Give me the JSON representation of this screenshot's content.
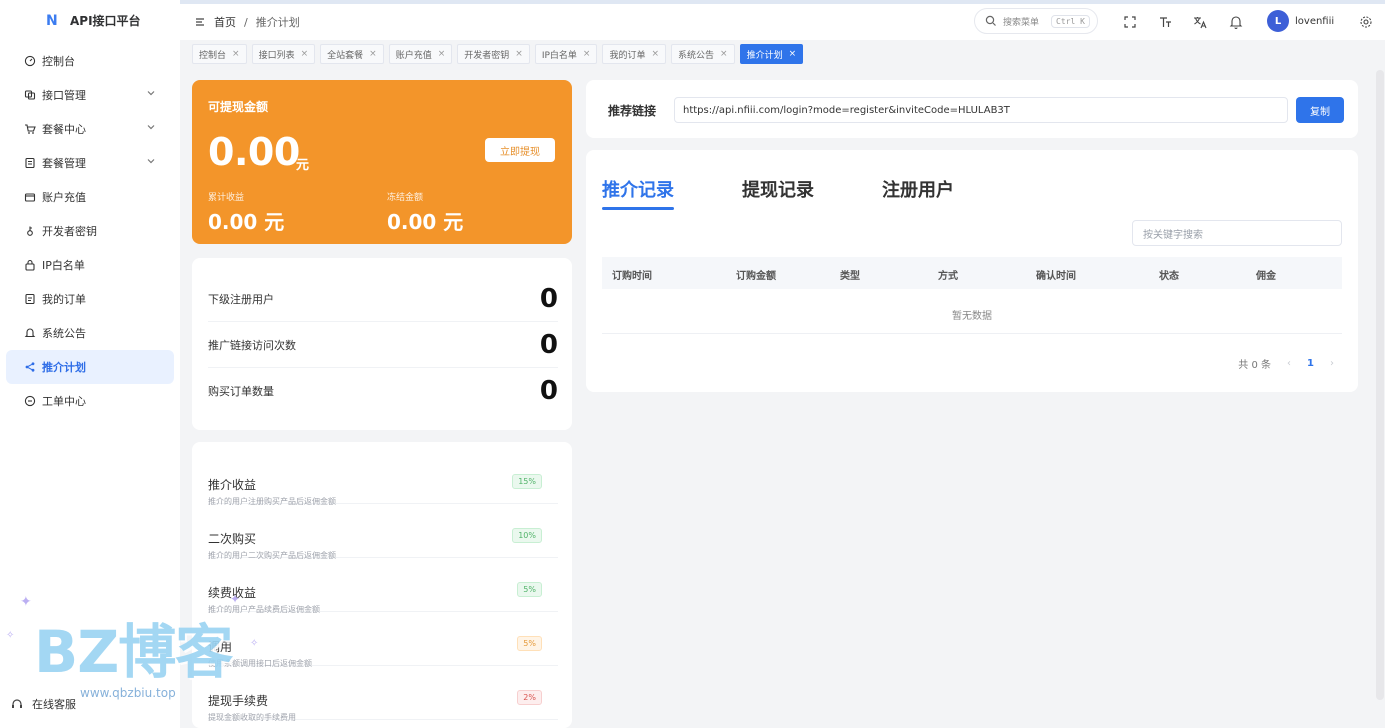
{
  "app": {
    "title": "API接口平台"
  },
  "sidebar": {
    "items": [
      {
        "label": "控制台",
        "icon": "dashboard-icon",
        "has_children": false,
        "active": false
      },
      {
        "label": "接口管理",
        "icon": "api-icon",
        "has_children": true,
        "active": false
      },
      {
        "label": "套餐中心",
        "icon": "cart-icon",
        "has_children": true,
        "active": false
      },
      {
        "label": "套餐管理",
        "icon": "package-icon",
        "has_children": true,
        "active": false
      },
      {
        "label": "账户充值",
        "icon": "wallet-icon",
        "has_children": false,
        "active": false
      },
      {
        "label": "开发者密钥",
        "icon": "key-icon",
        "has_children": false,
        "active": false
      },
      {
        "label": "IP白名单",
        "icon": "lock-icon",
        "has_children": false,
        "active": false
      },
      {
        "label": "我的订单",
        "icon": "order-icon",
        "has_children": false,
        "active": false
      },
      {
        "label": "系统公告",
        "icon": "bell-icon",
        "has_children": false,
        "active": false
      },
      {
        "label": "推介计划",
        "icon": "share-icon",
        "has_children": false,
        "active": true
      },
      {
        "label": "工单中心",
        "icon": "ticket-icon",
        "has_children": false,
        "active": false
      }
    ],
    "bottom": {
      "label": "在线客服"
    }
  },
  "header": {
    "breadcrumb": {
      "home": "首页",
      "sep": "/",
      "current": "推介计划"
    },
    "search": {
      "placeholder": "搜索菜单",
      "shortcut": "Ctrl K"
    },
    "user": {
      "name": "lovenfiii",
      "avatar_letter": "L"
    }
  },
  "tabs": [
    {
      "label": "控制台",
      "active": false
    },
    {
      "label": "接口列表",
      "active": false
    },
    {
      "label": "全站套餐",
      "active": false
    },
    {
      "label": "账户充值",
      "active": false
    },
    {
      "label": "开发者密钥",
      "active": false
    },
    {
      "label": "IP白名单",
      "active": false
    },
    {
      "label": "我的订单",
      "active": false
    },
    {
      "label": "系统公告",
      "active": false
    },
    {
      "label": "推介计划",
      "active": true
    }
  ],
  "balance": {
    "title": "可提现金额",
    "amount": "0.00",
    "unit": "元",
    "withdraw_label": "立即提现",
    "total_label": "累计收益",
    "total_value": "0.00 元",
    "frozen_label": "冻结金额",
    "frozen_value": "0.00 元"
  },
  "stats": [
    {
      "label": "下级注册用户",
      "value": "0"
    },
    {
      "label": "推广链接访问次数",
      "value": "0"
    },
    {
      "label": "购买订单数量",
      "value": "0"
    }
  ],
  "rates": [
    {
      "title": "推介收益",
      "desc": "推介的用户注册购买产品后返佣金额",
      "badge": "15%",
      "badge_type": "green"
    },
    {
      "title": "二次购买",
      "desc": "推介的用户二次购买产品后返佣金额",
      "badge": "10%",
      "badge_type": "green"
    },
    {
      "title": "续费收益",
      "desc": "推介的用户产品续费后返佣金额",
      "badge": "5%",
      "badge_type": "green"
    },
    {
      "title": "调用",
      "desc": "使用余额调用接口后返佣金额",
      "badge": "5%",
      "badge_type": "orange"
    },
    {
      "title": "提现手续费",
      "desc": "提现金额收取的手续费用",
      "badge": "2%",
      "badge_type": "red"
    }
  ],
  "referral": {
    "label": "推荐链接",
    "url": "https://api.nfiii.com/login?mode=register&inviteCode=HLULAB3T",
    "copy_label": "复制"
  },
  "records": {
    "tabs": [
      {
        "label": "推介记录",
        "active": true
      },
      {
        "label": "提现记录",
        "active": false
      },
      {
        "label": "注册用户",
        "active": false
      }
    ],
    "search_placeholder": "按关键字搜索",
    "columns": [
      "订购时间",
      "订购金额",
      "类型",
      "方式",
      "确认时间",
      "状态",
      "佣金"
    ],
    "empty_text": "暂无数据",
    "pager": {
      "total": "共 0 条",
      "page": "1"
    }
  },
  "watermark": {
    "text": "BZ博客",
    "url": "www.qbzbiu.top"
  },
  "colors": {
    "accent": "#2f74ea",
    "orange": "#f3952a"
  }
}
